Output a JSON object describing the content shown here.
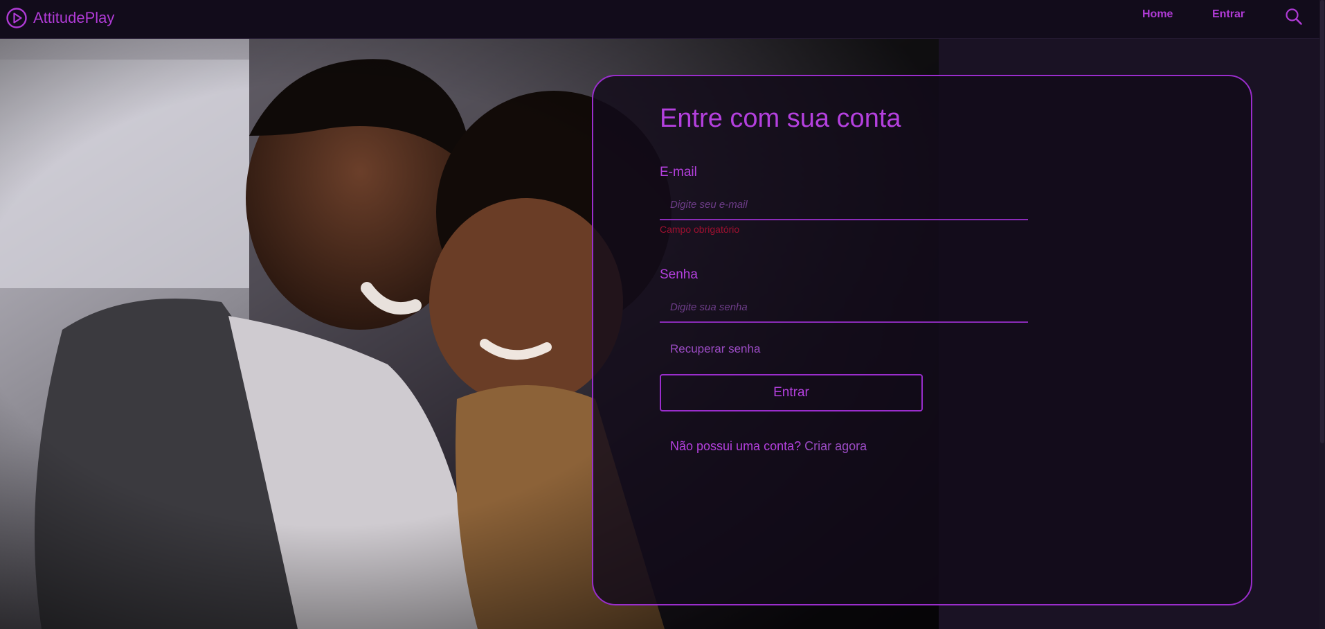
{
  "brand": {
    "name": "AttitudePlay",
    "logo_icon": "play-circle-icon"
  },
  "nav": {
    "home_label": "Home",
    "entrar_label": "Entrar",
    "search_icon": "search-icon"
  },
  "login": {
    "title": "Entre com sua conta",
    "email_label": "E-mail",
    "email_placeholder": "Digite seu e-mail",
    "email_value": "",
    "email_error": "Campo obrigatório",
    "password_label": "Senha",
    "password_placeholder": "Digite sua senha",
    "password_value": "",
    "recover_label": "Recuperar senha",
    "submit_label": "Entrar",
    "signup_question": "Não possui uma conta?",
    "signup_link": "Criar agora"
  },
  "colors": {
    "accent": "#b440de",
    "background": "#16101f",
    "error": "#9e1030"
  }
}
